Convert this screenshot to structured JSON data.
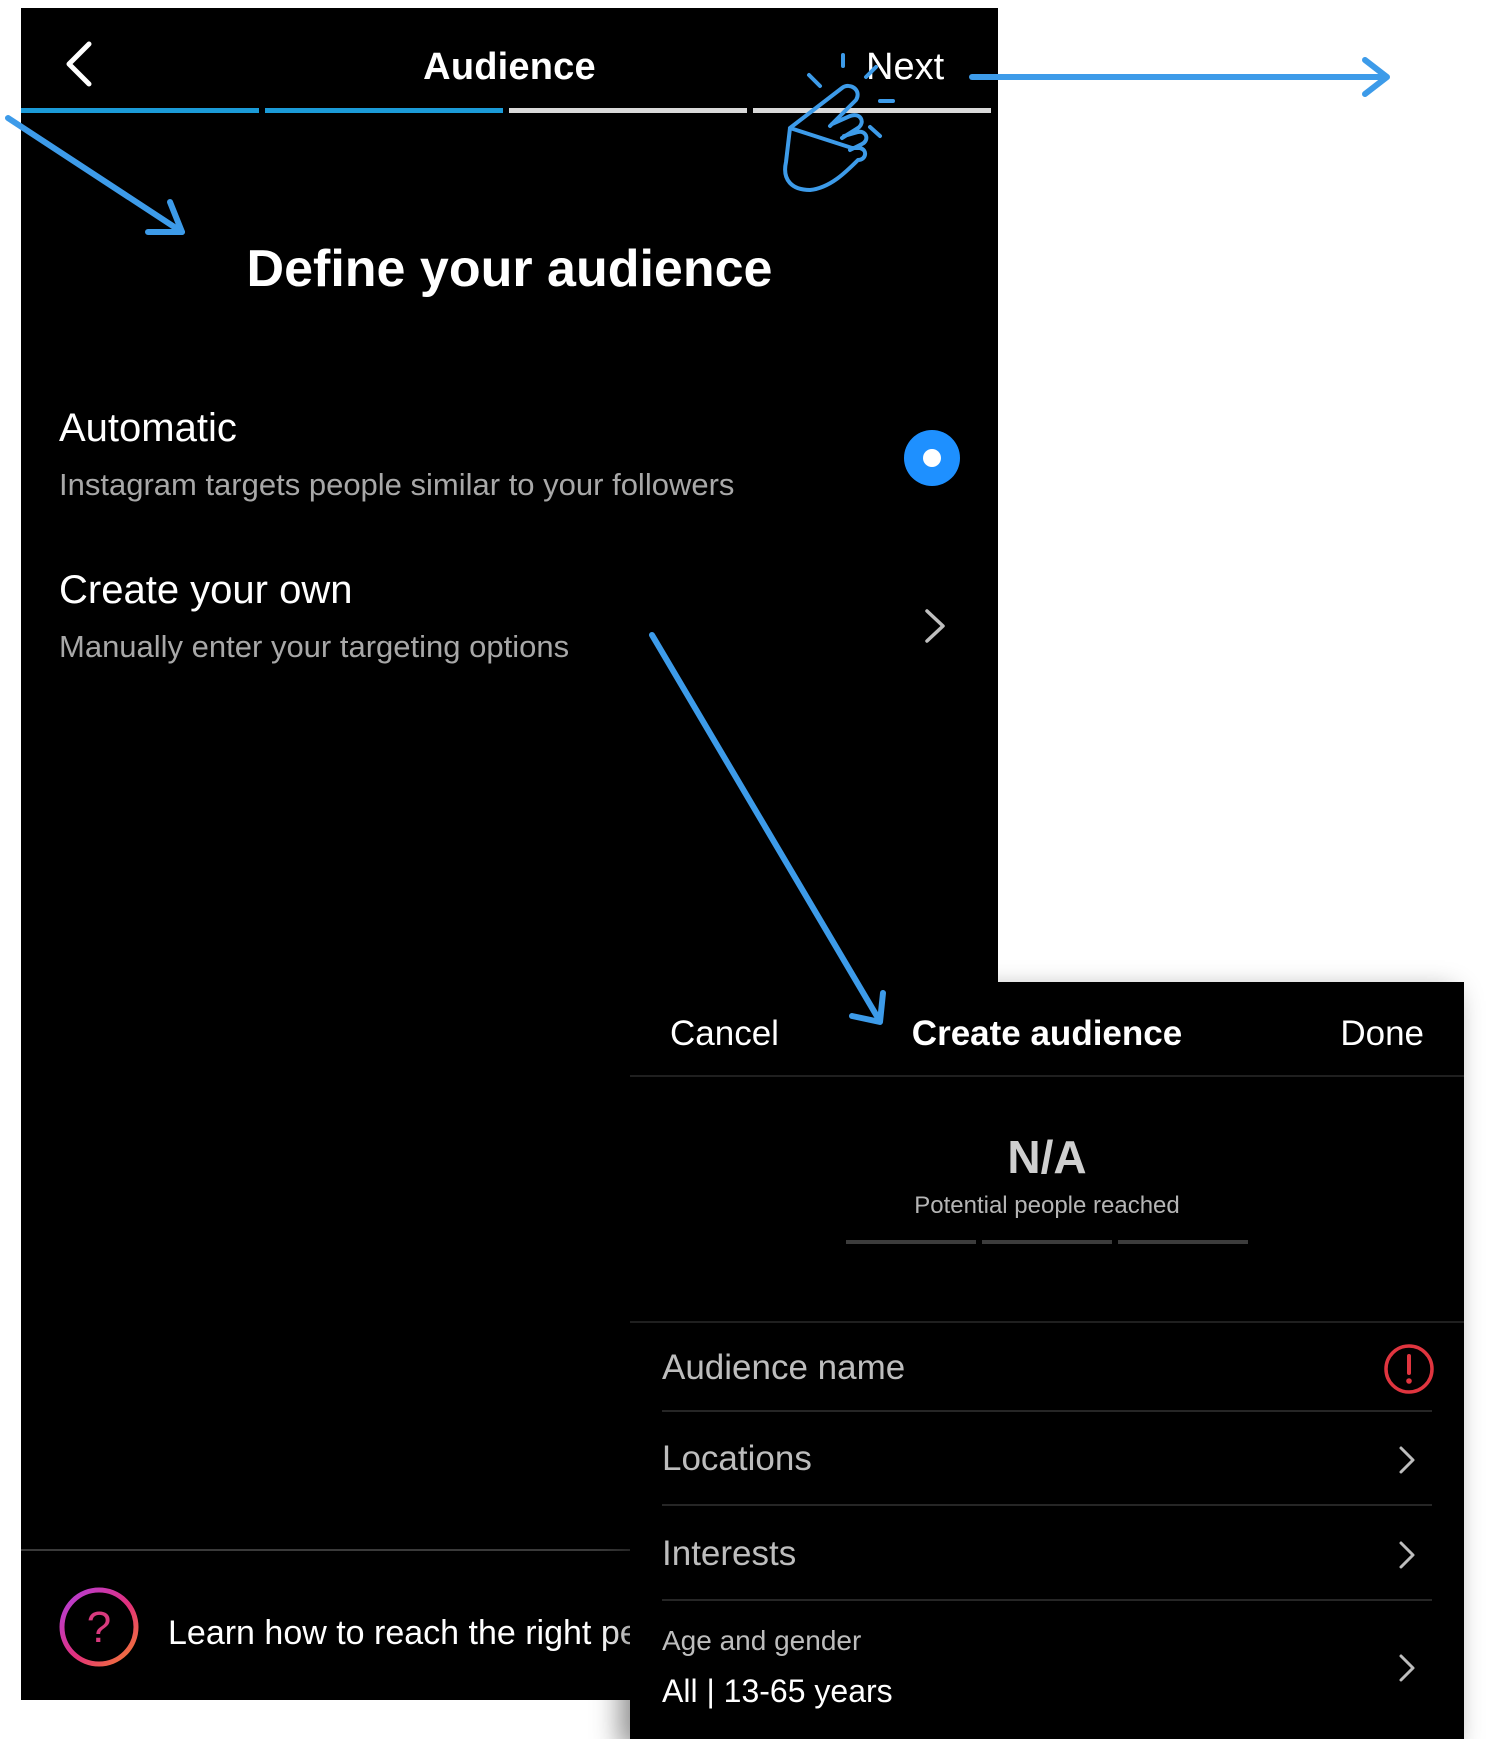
{
  "nav": {
    "title": "Audience",
    "next_label": "Next"
  },
  "progress": {
    "total_steps": 4,
    "completed_steps": 2,
    "active_color": "#1b9bd8",
    "inactive_color": "#d9d9d9"
  },
  "page": {
    "heading": "Define your audience"
  },
  "options": [
    {
      "title": "Automatic",
      "description": "Instagram targets people similar to your followers",
      "selected": true
    },
    {
      "title": "Create your own",
      "description": "Manually enter your targeting options"
    }
  ],
  "footer": {
    "help_text": "Learn how to reach the right pe"
  },
  "create_audience": {
    "cancel_label": "Cancel",
    "title": "Create audience",
    "done_label": "Done",
    "reach_value": "N/A",
    "reach_label": "Potential people reached",
    "rows": {
      "audience_name": "Audience name",
      "locations": "Locations",
      "interests": "Interests",
      "age_gender_label": "Age and gender",
      "age_gender_value": "All | 13-65 years"
    }
  },
  "colors": {
    "accent_blue": "#1e90ff",
    "annotation_blue": "#3d9be9",
    "alert_red": "#e0353f"
  },
  "icons": {
    "back": "chevron-left-icon",
    "radio": "radio-selected-icon",
    "chevron": "chevron-right-icon",
    "help": "question-circle-icon",
    "alert": "exclamation-circle-icon",
    "tap": "tap-hand-icon"
  }
}
